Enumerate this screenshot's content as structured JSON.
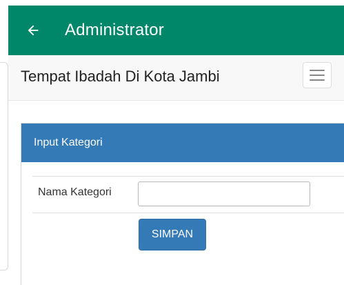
{
  "appbar": {
    "title": "Administrator",
    "back_icon": "arrow-left-icon",
    "color": "#00876a"
  },
  "site": {
    "brand": "Tempat Ibadah Di Kota Jambi",
    "menu_icon": "hamburger-menu-icon"
  },
  "panel": {
    "heading": "Input Kategori",
    "heading_color": "#337ab7"
  },
  "form": {
    "label": "Nama Kategori",
    "value": "",
    "submit_label": "SIMPAN"
  }
}
